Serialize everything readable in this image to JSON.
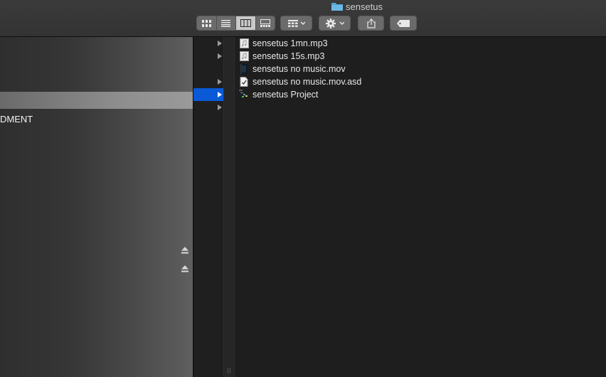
{
  "window": {
    "title": "sensetus",
    "folder_icon": "folder-icon"
  },
  "toolbar": {
    "view_buttons": [
      "icon-view",
      "list-view",
      "column-view",
      "gallery-view"
    ],
    "active_view": "column-view",
    "group_icon": "group-grid-icon",
    "action_icon": "gear-icon",
    "share_icon": "share-icon",
    "tag_icon": "tag-icon"
  },
  "sidebar": {
    "partial_label": "DMENT",
    "eject_icons": [
      "eject-icon",
      "eject-icon"
    ]
  },
  "files": [
    {
      "name": "sensetus 1mn.mp3",
      "icon": "audio-file-icon"
    },
    {
      "name": "sensetus 15s.mp3",
      "icon": "audio-file-icon"
    },
    {
      "name": "sensetus no music.mov",
      "icon": "movie-file-icon"
    },
    {
      "name": "sensetus no music.mov.asd",
      "icon": "document-file-icon"
    },
    {
      "name": "sensetus Project",
      "icon": "project-file-icon"
    }
  ],
  "colors": {
    "selection": "#0a5ad8",
    "background": "#1e1e1e"
  }
}
